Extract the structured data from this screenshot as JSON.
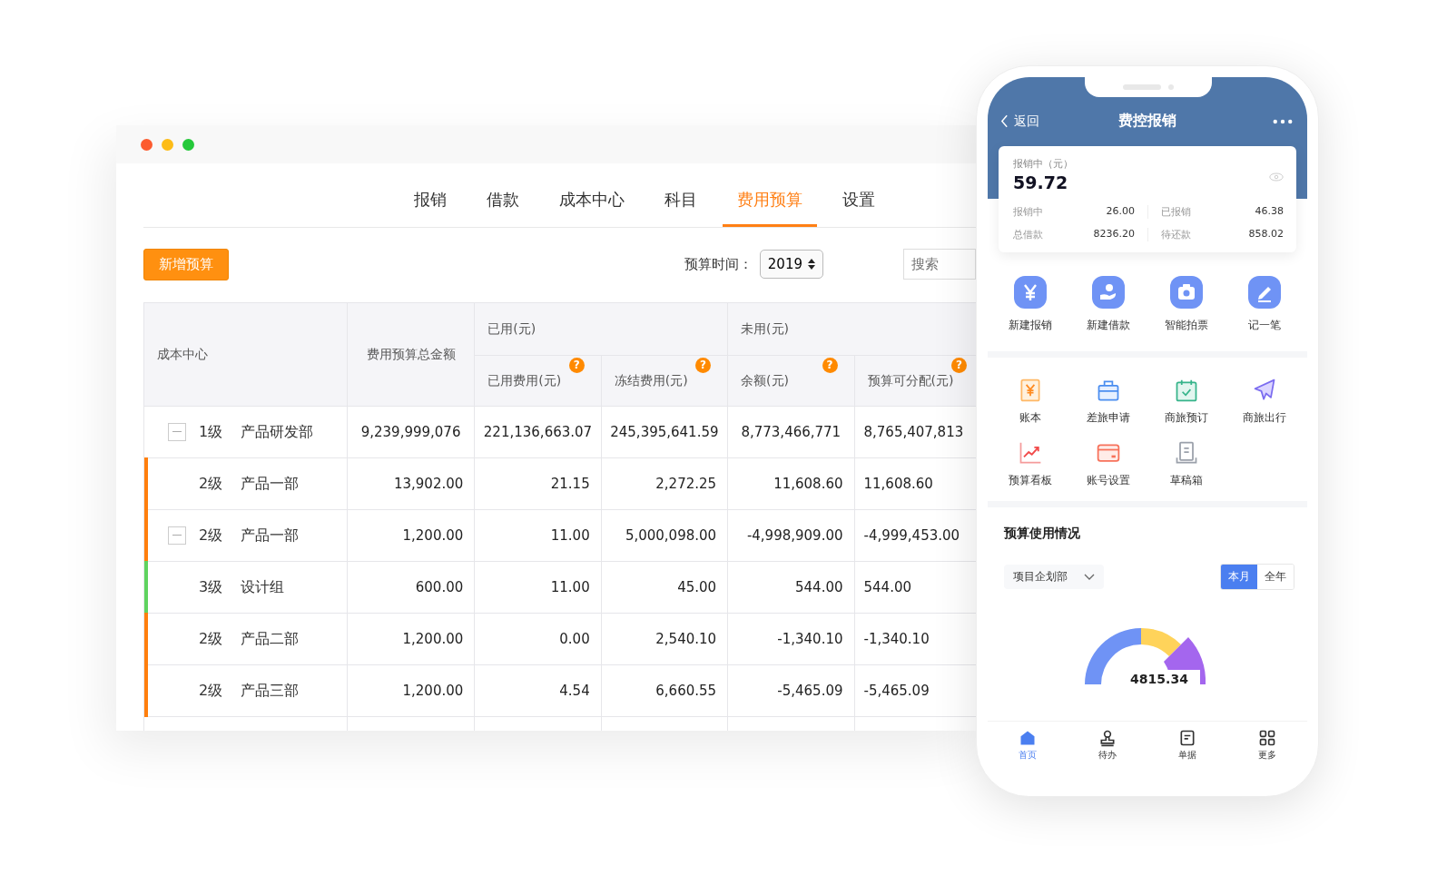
{
  "desktop": {
    "tabs": [
      {
        "label": "报销",
        "selected": false
      },
      {
        "label": "借款",
        "selected": false
      },
      {
        "label": "成本中心",
        "selected": false
      },
      {
        "label": "科目",
        "selected": false
      },
      {
        "label": "费用预算",
        "selected": true
      },
      {
        "label": "设置",
        "selected": false
      }
    ],
    "add_button": "新增预算",
    "time_label": "预算时间：",
    "year": "2019",
    "search": {
      "placeholder": "搜索"
    },
    "table": {
      "columns": {
        "cost_center": "成本中心",
        "total": "费用预算总金额",
        "used_group": "已用(元)",
        "unused_group": "未用(元)",
        "sub": [
          {
            "label": "已用费用(元)",
            "help": "?"
          },
          {
            "label": "冻结费用(元)",
            "help": "?"
          },
          {
            "label": "余额(元)",
            "help": "?"
          },
          {
            "label": "预算可分配(元)",
            "help": "?"
          }
        ]
      },
      "rows": [
        {
          "level": "1级",
          "name": "产品研发部",
          "expanded": true,
          "values": [
            "9,239,999,076",
            "221,136,663.07",
            "245,395,641.59",
            "8,773,466,771",
            "8,765,407,813"
          ]
        },
        {
          "level": "2级",
          "name": "产品一部",
          "color": "#ff7f0e",
          "values": [
            "13,902.00",
            "21.15",
            "2,272.25",
            "11,608.60",
            "11,608.60"
          ]
        },
        {
          "level": "2级",
          "name": "产品一部",
          "color": "#ff7f0e",
          "expanded": true,
          "values": [
            "1,200.00",
            "11.00",
            "5,000,098.00",
            "-4,998,909.00",
            "-4,999,453.00"
          ]
        },
        {
          "level": "3级",
          "name": "设计组",
          "color": "#5fd35f",
          "values": [
            "600.00",
            "11.00",
            "45.00",
            "544.00",
            "544.00"
          ]
        },
        {
          "level": "2级",
          "name": "产品二部",
          "color": "#ff7f0e",
          "values": [
            "1,200.00",
            "0.00",
            "2,540.10",
            "-1,340.10",
            "-1,340.10"
          ]
        },
        {
          "level": "2级",
          "name": "产品三部",
          "color": "#ff7f0e",
          "values": [
            "1,200.00",
            "4.54",
            "6,660.55",
            "-5,465.09",
            "-5,465.09"
          ]
        }
      ]
    }
  },
  "phone": {
    "back": "返回",
    "title": "费控报销",
    "summary": {
      "label": "报销中（元）",
      "amount": "59.72",
      "stats": [
        {
          "label": "报销中",
          "value": "26.00"
        },
        {
          "label": "已报销",
          "value": "46.38"
        },
        {
          "label": "总借款",
          "value": "8236.20"
        },
        {
          "label": "待还款",
          "value": "858.02"
        }
      ]
    },
    "quick_actions": [
      {
        "label": "新建报销",
        "kind": "yen"
      },
      {
        "label": "新建借款",
        "kind": "hand"
      },
      {
        "label": "智能拍票",
        "kind": "camera"
      },
      {
        "label": "记一笔",
        "kind": "pen"
      }
    ],
    "tools": [
      {
        "label": "账本",
        "kind": "ledger"
      },
      {
        "label": "差旅申请",
        "kind": "bag"
      },
      {
        "label": "商旅预订",
        "kind": "calendar"
      },
      {
        "label": "商旅出行",
        "kind": "plane"
      },
      {
        "label": "预算看板",
        "kind": "trend"
      },
      {
        "label": "账号设置",
        "kind": "card"
      },
      {
        "label": "草稿箱",
        "kind": "drafts"
      }
    ],
    "budget": {
      "title": "预算使用情况",
      "department": "项目企划部",
      "periods": [
        {
          "label": "本月",
          "selected": true
        },
        {
          "label": "全年",
          "selected": false
        }
      ],
      "total": "4815.34"
    },
    "nav": [
      {
        "label": "首页",
        "kind": "home",
        "selected": true
      },
      {
        "label": "待办",
        "kind": "stamp",
        "selected": false
      },
      {
        "label": "单据",
        "kind": "doc",
        "selected": false
      },
      {
        "label": "更多",
        "kind": "grid",
        "selected": false
      }
    ]
  }
}
